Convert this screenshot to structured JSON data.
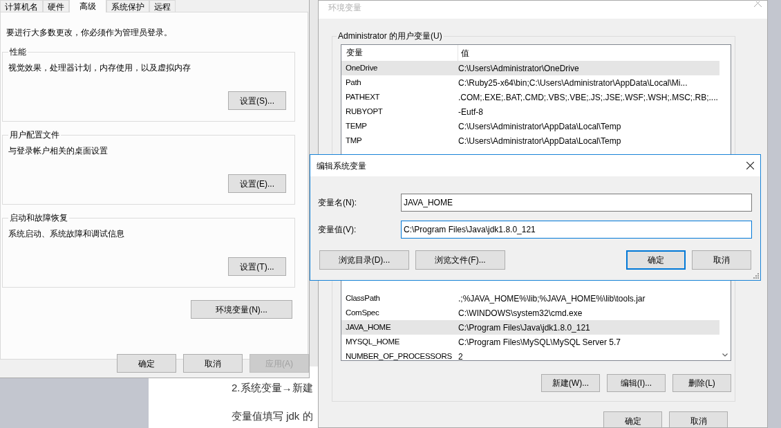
{
  "background_page": {
    "lines": [
      "2.系统变量→新建",
      "变量值填写 jdk 的"
    ]
  },
  "system_properties": {
    "tabs": [
      {
        "label": "计算机名",
        "selected": false
      },
      {
        "label": "硬件",
        "selected": false
      },
      {
        "label": "高级",
        "selected": true
      },
      {
        "label": "系统保护",
        "selected": false
      },
      {
        "label": "远程",
        "selected": false
      }
    ],
    "notice": "要进行大多数更改，你必须作为管理员登录。",
    "groups": [
      {
        "title": "性能",
        "description": "视觉效果，处理器计划，内存使用，以及虚拟内存",
        "button": "设置(S)..."
      },
      {
        "title": "用户配置文件",
        "description": "与登录帐户相关的桌面设置",
        "button": "设置(E)..."
      },
      {
        "title": "启动和故障恢复",
        "description": "系统启动、系统故障和调试信息",
        "button": "设置(T)..."
      }
    ],
    "env_button": "环境变量(N)...",
    "buttons": [
      {
        "label": "确定",
        "disabled": false
      },
      {
        "label": "取消",
        "disabled": false
      },
      {
        "label": "应用(A)",
        "disabled": true
      }
    ]
  },
  "env_window": {
    "title": "环境变量",
    "user_vars": {
      "title": "Administrator 的用户变量(U)",
      "columns": [
        "变量",
        "值"
      ],
      "rows": [
        {
          "name": "OneDrive",
          "value": "C:\\Users\\Administrator\\OneDrive",
          "selected": true
        },
        {
          "name": "Path",
          "value": "C:\\Ruby25-x64\\bin;C:\\Users\\Administrator\\AppData\\Local\\Mi...",
          "selected": false
        },
        {
          "name": "PATHEXT",
          "value": ".COM;.EXE;.BAT;.CMD;.VBS;.VBE;.JS;.JSE;.WSF;.WSH;.MSC;.RB;....",
          "selected": false
        },
        {
          "name": "RUBYOPT",
          "value": "-Eutf-8",
          "selected": false
        },
        {
          "name": "TEMP",
          "value": "C:\\Users\\Administrator\\AppData\\Local\\Temp",
          "selected": false
        },
        {
          "name": "TMP",
          "value": "C:\\Users\\Administrator\\AppData\\Local\\Temp",
          "selected": false
        }
      ]
    },
    "system_vars": {
      "rows": [
        {
          "name": "ClassPath",
          "value": ".;%JAVA_HOME%\\lib;%JAVA_HOME%\\lib\\tools.jar",
          "selected": false
        },
        {
          "name": "ComSpec",
          "value": "C:\\WINDOWS\\system32\\cmd.exe",
          "selected": false
        },
        {
          "name": "JAVA_HOME",
          "value": "C:\\Program Files\\Java\\jdk1.8.0_121",
          "selected": true
        },
        {
          "name": "MYSQL_HOME",
          "value": "C:\\Program Files\\MySQL\\MySQL Server 5.7",
          "selected": false
        },
        {
          "name": "NUMBER_OF_PROCESSORS",
          "value": "2",
          "selected": false
        }
      ],
      "buttons": [
        "新建(W)...",
        "编辑(I)...",
        "删除(L)"
      ]
    },
    "buttons": [
      "确定",
      "取消"
    ]
  },
  "edit_dialog": {
    "title": "编辑系统变量",
    "fields": [
      {
        "label": "变量名(N):",
        "value": "JAVA_HOME",
        "focused": false
      },
      {
        "label": "变量值(V):",
        "value": "C:\\Program Files\\Java\\jdk1.8.0_121",
        "focused": true
      }
    ],
    "browse_buttons": [
      "浏览目录(D)...",
      "浏览文件(F)..."
    ],
    "buttons": [
      {
        "label": "确定",
        "default": true
      },
      {
        "label": "取消",
        "default": false
      }
    ]
  }
}
